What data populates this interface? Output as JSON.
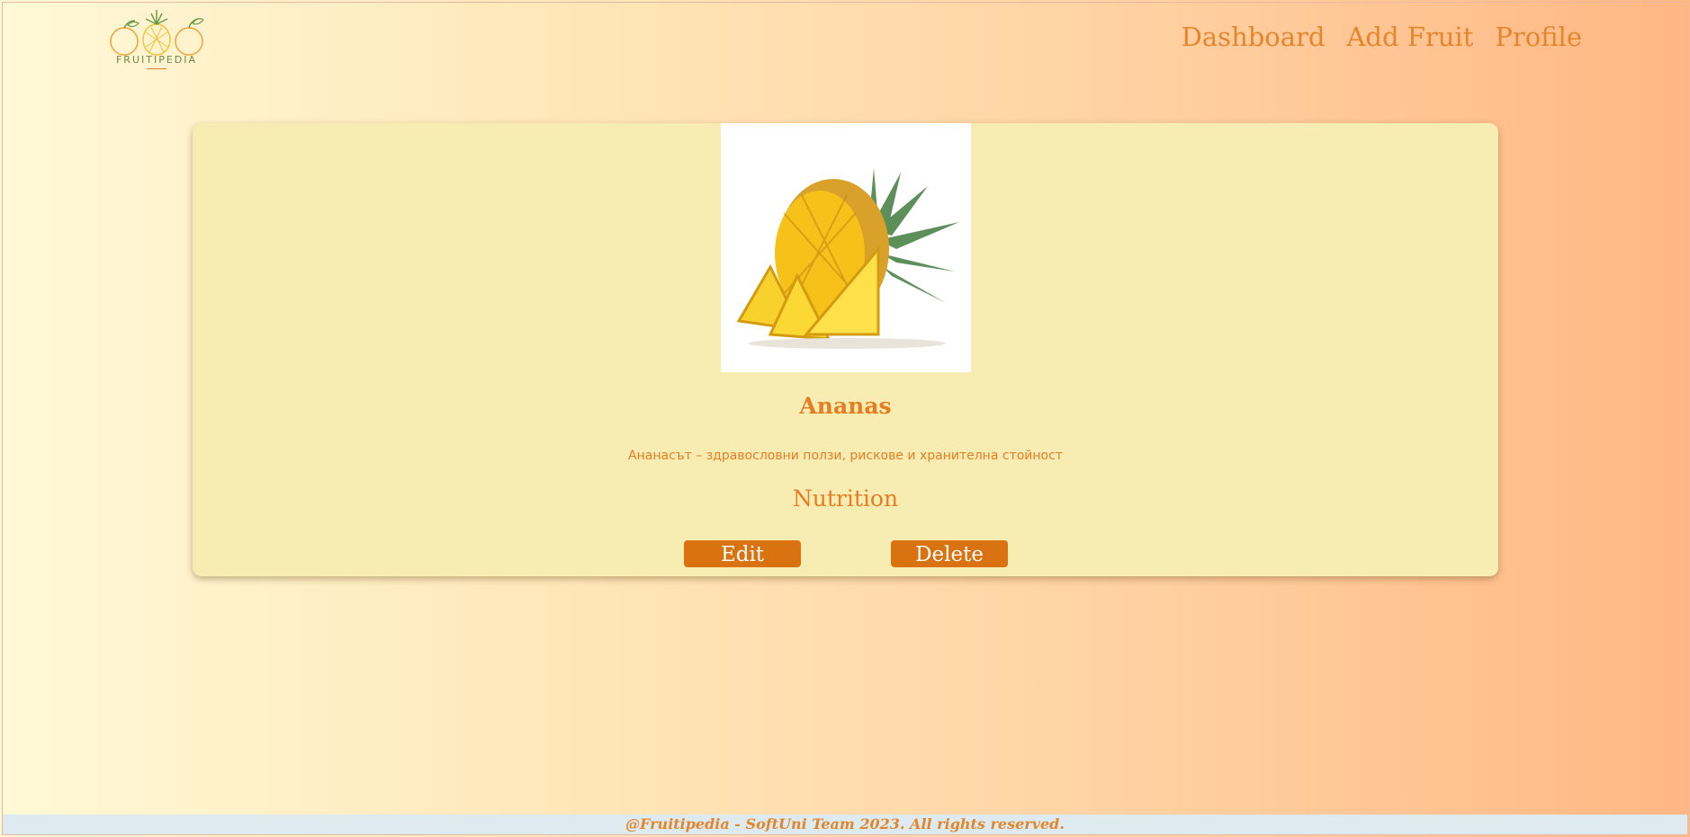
{
  "logo": {
    "text": "FRUITIPEDIA"
  },
  "nav": {
    "items": [
      "Dashboard",
      "Add Fruit",
      "Profile"
    ]
  },
  "fruit": {
    "name": "Ananas",
    "description": "Ананасът – здравословни ползи, рискове и хранителна стойност",
    "nutrition_label": "Nutrition",
    "image_icon": "pineapple-image"
  },
  "actions": {
    "edit_label": "Edit",
    "delete_label": "Delete"
  },
  "footer": {
    "text": "@Fruitipedia - SoftUni Team 2023. All rights reserved."
  }
}
